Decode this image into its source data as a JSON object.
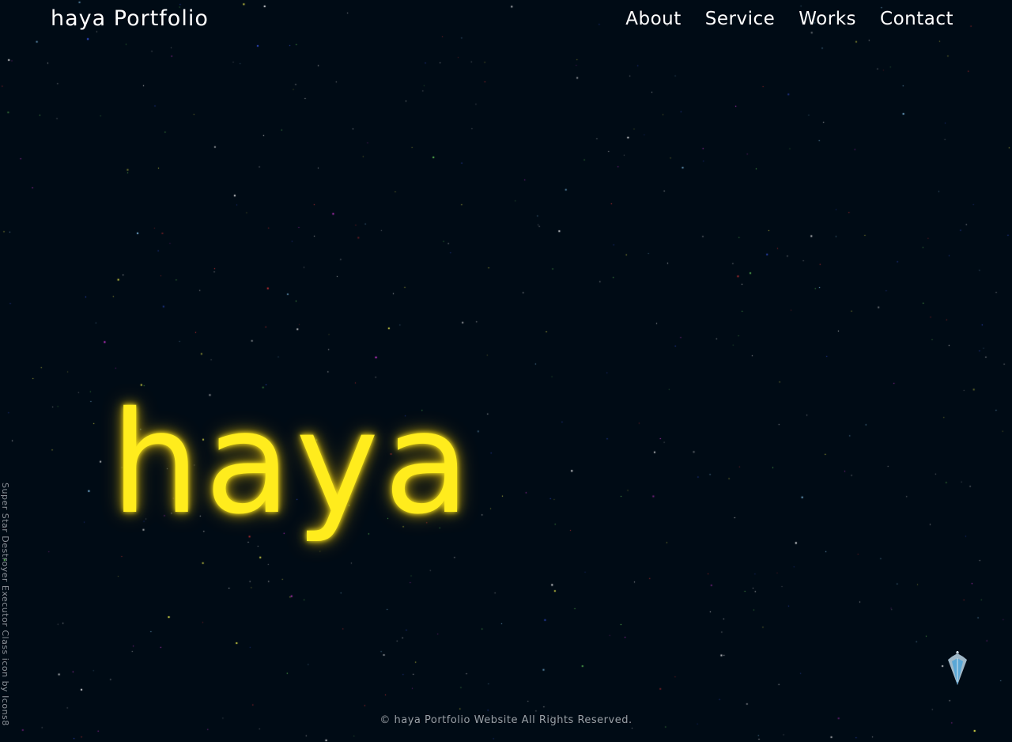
{
  "header": {
    "logo": "haya Portfolio"
  },
  "nav": {
    "items": [
      {
        "label": "About"
      },
      {
        "label": "Service"
      },
      {
        "label": "Works"
      },
      {
        "label": "Contact"
      }
    ]
  },
  "hero": {
    "title": "haya"
  },
  "credit": {
    "text": "Super Star Destroyer Executor Class icon by Icons8"
  },
  "scroll_button": {
    "icon": "star-destroyer-icon"
  },
  "footer": {
    "text": "© haya Portfolio Website All Rights Reserved."
  },
  "colors": {
    "background": "#000b15",
    "title_glow": "#ffec1d",
    "text": "#ffffff",
    "muted": "#9aa0a6"
  }
}
